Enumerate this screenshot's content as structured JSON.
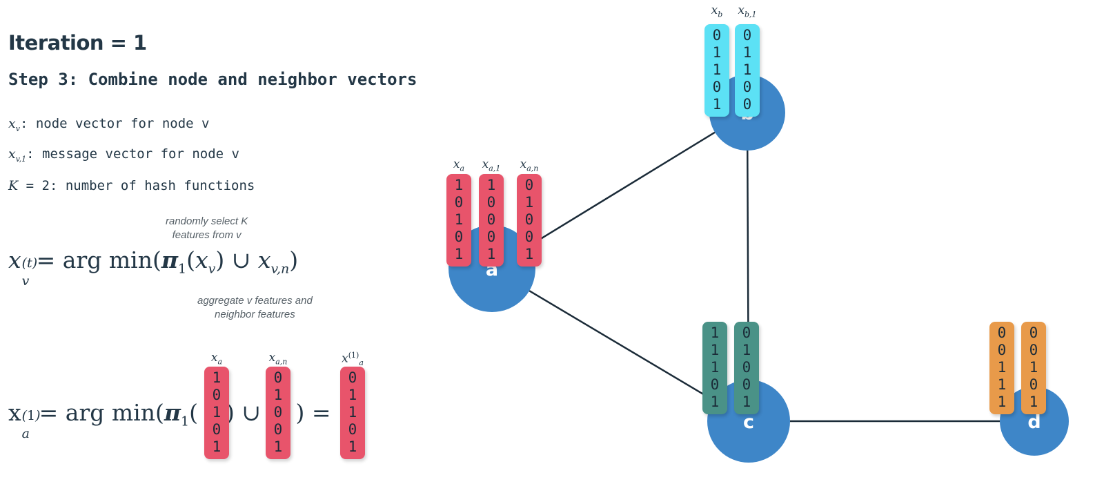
{
  "slide": {
    "iteration_title": "Iteration = 1",
    "step_title": "Step 3: Combine node and neighbor vectors",
    "legend": [
      {
        "symbol": "x",
        "sub": "v",
        "text": ": node vector for node v"
      },
      {
        "symbol": "x",
        "sub": "v,1",
        "text": ": message vector for node v"
      },
      {
        "symbol": "K",
        "sub": "",
        "text": " = 2: number of hash functions"
      }
    ],
    "annotations": {
      "top_line1": "randomly select K",
      "top_line2": "features from v",
      "bottom_line1": "aggregate v features and",
      "bottom_line2": "neighbor features"
    },
    "formula_general": "x_v^(t) = arg min( pi_1( x_v ) U x_v,n )",
    "formula_result": "x_a^(1) = arg min( pi_1( [vector] ) U [vector] ) = [vector]",
    "formula_tokens": {
      "equals": "=",
      "argmin": "arg min",
      "pi": "π",
      "union": "∪",
      "open_paren": "(",
      "close_paren": ")",
      "x": "x",
      "K": "K",
      "two": "2",
      "t": "t",
      "one": "1",
      "v": "v",
      "a": "a",
      "vn": "v,n"
    }
  },
  "result_vectors": [
    {
      "name": "x_a",
      "label_base": "x",
      "label_sub": "a",
      "label_sup": "",
      "color": "#e8546b",
      "bits": [
        "1",
        "0",
        "1",
        "0",
        "1"
      ]
    },
    {
      "name": "x_a_n",
      "label_base": "x",
      "label_sub": "a,n",
      "label_sup": "",
      "color": "#e8546b",
      "bits": [
        "0",
        "1",
        "0",
        "0",
        "1"
      ]
    },
    {
      "name": "x_a_1_result",
      "label_base": "x",
      "label_sub": "a",
      "label_sup": "(1)",
      "color": "#e8546b",
      "bits": [
        "0",
        "1",
        "1",
        "0",
        "1"
      ]
    }
  ],
  "graph": {
    "nodes": [
      {
        "id": "a",
        "letter": "a",
        "circle_color": "#3e86c8",
        "vector_color": "#e8546b",
        "vectors": [
          {
            "label_base": "x",
            "label_sub": "a",
            "bits": [
              "1",
              "0",
              "1",
              "0",
              "1"
            ]
          },
          {
            "label_base": "x",
            "label_sub": "a,1",
            "bits": [
              "1",
              "0",
              "0",
              "0",
              "1"
            ]
          },
          {
            "label_base": "x",
            "label_sub": "a,n",
            "bits": [
              "0",
              "1",
              "0",
              "0",
              "1"
            ]
          }
        ]
      },
      {
        "id": "b",
        "letter": "b",
        "circle_color": "#3e86c8",
        "vector_color": "#5ce1f5",
        "vectors": [
          {
            "label_base": "x",
            "label_sub": "b",
            "bits": [
              "0",
              "1",
              "1",
              "0",
              "1"
            ]
          },
          {
            "label_base": "x",
            "label_sub": "b,1",
            "bits": [
              "0",
              "1",
              "1",
              "0",
              "0"
            ]
          }
        ]
      },
      {
        "id": "c",
        "letter": "c",
        "circle_color": "#3e86c8",
        "vector_color": "#4a9287",
        "vectors": [
          {
            "label_base": "",
            "label_sub": "",
            "bits": [
              "1",
              "1",
              "1",
              "0",
              "1"
            ]
          },
          {
            "label_base": "",
            "label_sub": "",
            "bits": [
              "0",
              "1",
              "0",
              "0",
              "1"
            ]
          }
        ]
      },
      {
        "id": "d",
        "letter": "d",
        "circle_color": "#3e86c8",
        "vector_color": "#e89a4a",
        "vectors": [
          {
            "label_base": "",
            "label_sub": "",
            "bits": [
              "0",
              "0",
              "1",
              "1",
              "1"
            ]
          },
          {
            "label_base": "",
            "label_sub": "",
            "bits": [
              "0",
              "0",
              "1",
              "0",
              "1"
            ]
          }
        ]
      }
    ],
    "edges": [
      {
        "from": "a",
        "to": "b"
      },
      {
        "from": "a",
        "to": "c"
      },
      {
        "from": "b",
        "to": "c"
      },
      {
        "from": "c",
        "to": "d"
      }
    ],
    "edge_color": "#1b2b38"
  },
  "colors": {
    "text_dark": "#233746",
    "annotation": "#555f66",
    "node_blue": "#3e86c8",
    "vector_pink": "#e8546b",
    "vector_cyan": "#5ce1f5",
    "vector_green": "#4a9287",
    "vector_orange": "#e89a4a",
    "background": "#ffffff"
  }
}
